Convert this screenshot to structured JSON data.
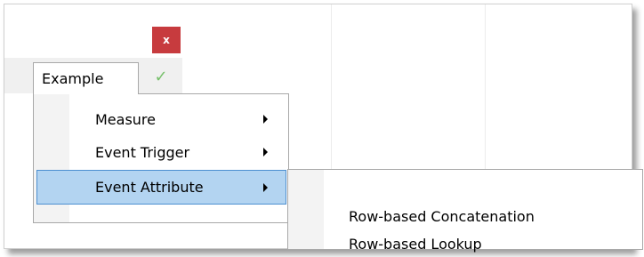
{
  "toolbar": {
    "close_label": "x",
    "tab_label": "Example",
    "check_glyph": "✓"
  },
  "menu": {
    "items": [
      {
        "label": "Measure",
        "has_submenu": true
      },
      {
        "label": "Event Trigger",
        "has_submenu": true
      },
      {
        "label": "Event Attribute",
        "has_submenu": true,
        "highlighted": true
      }
    ]
  },
  "submenu": {
    "items": [
      {
        "label": "Row-based Concatenation"
      },
      {
        "label": "Row-based Lookup"
      }
    ]
  },
  "colors": {
    "close_bg": "#c73b3e",
    "highlight_bg": "#b3d4f1",
    "highlight_border": "#4d8fd0",
    "check": "#77c06b"
  }
}
